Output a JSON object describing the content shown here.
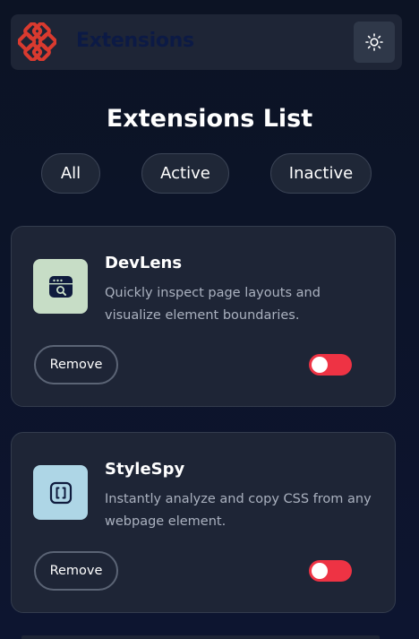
{
  "header": {
    "brand": "Extensions",
    "logo_icon": "extensions-logo-icon",
    "theme_icon": "sun-icon",
    "logo_color": "#d93a2f"
  },
  "title": "Extensions List",
  "filters": [
    "All",
    "Active",
    "Inactive"
  ],
  "extensions": [
    {
      "name": "DevLens",
      "description_lines": [
        "Quickly inspect page layouts and",
        "visualize element boundaries."
      ],
      "icon": "devlens-icon",
      "icon_bg": "#c7ddc6",
      "remove_label": "Remove",
      "enabled": false
    },
    {
      "name": "StyleSpy",
      "description_lines": [
        "Instantly analyze and copy CSS from any",
        "webpage element."
      ],
      "icon": "stylespy-icon",
      "icon_bg": "#aed6e6",
      "remove_label": "Remove",
      "enabled": false
    }
  ],
  "colors": {
    "background": "#0c1324",
    "card": "#1e2536",
    "toggle_accent": "#ee3344"
  }
}
